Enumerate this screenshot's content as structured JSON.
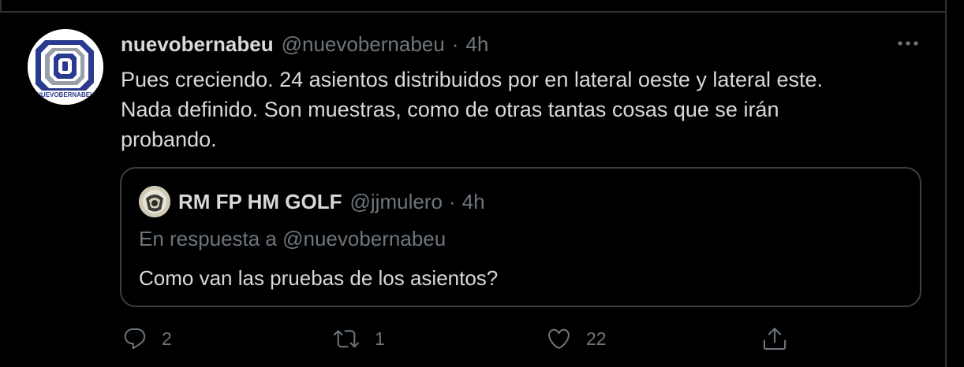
{
  "tweet": {
    "display_name": "nuevobernabeu",
    "handle": "@nuevobernabeu",
    "separator": "·",
    "time": "4h",
    "text": "Pues creciendo. 24 asientos distribuidos por en lateral oeste y lateral este.\nNada definido. Son muestras, como de otras tantas cosas que se irán\nprobando.",
    "avatar_text": "NUEVOBERNABEU"
  },
  "quoted_tweet": {
    "display_name": "RM FP HM GOLF",
    "handle": "@jjmulero",
    "separator": "·",
    "time": "4h",
    "reply_context": "En respuesta a @nuevobernabeu",
    "text": "Como van las pruebas de los asientos?"
  },
  "actions": {
    "reply_count": "2",
    "retweet_count": "1",
    "like_count": "22"
  },
  "icons": {
    "more": "more-horizontal-icon",
    "reply": "speech-bubble-icon",
    "retweet": "retweet-arrows-icon",
    "like": "heart-icon",
    "share": "share-upload-icon"
  },
  "colors": {
    "background": "#000000",
    "text": "#d9d9d9",
    "secondary": "#6e767d",
    "border": "#2f3336",
    "logo_blue": "#2a3b8f"
  }
}
